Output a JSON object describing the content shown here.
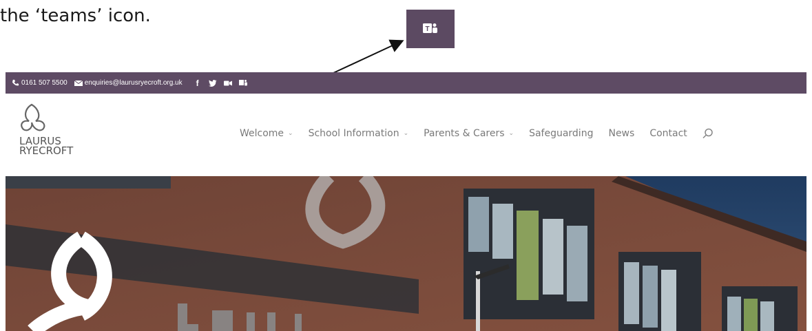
{
  "caption": {
    "text": "the ‘teams’ icon."
  },
  "topbar": {
    "phone": "0161 507 5500",
    "email": "enquiries@laurusryecroft.org.uk",
    "icons": [
      "phone-icon",
      "mail-icon",
      "facebook-icon",
      "twitter-icon",
      "video-icon",
      "teams-icon"
    ],
    "background": "#5e4b64"
  },
  "logo": {
    "line1": "LAURUS",
    "line2": "RYECROFT"
  },
  "nav": {
    "welcome": "Welcome",
    "school_information": "School Information",
    "parents_carers": "Parents & Carers",
    "safeguarding": "Safeguarding",
    "news": "News",
    "contact": "Contact"
  },
  "colors": {
    "brand_purple": "#5e4b64",
    "brick": "#7a4a3a",
    "sky": "#2d4a6e"
  }
}
